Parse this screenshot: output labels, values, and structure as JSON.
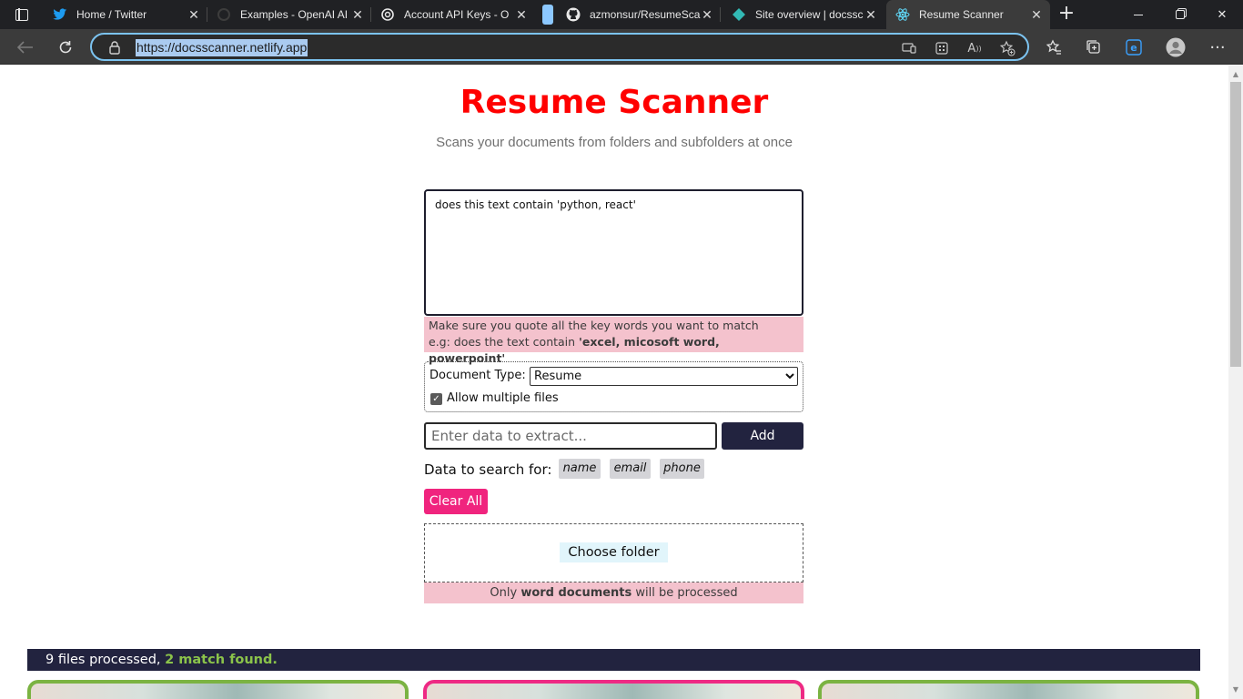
{
  "browser": {
    "tabs": [
      {
        "title": "",
        "icon": "tab-actions-icon"
      },
      {
        "title": "Home / Twitter",
        "icon": "twitter-icon"
      },
      {
        "title": "Examples - OpenAI AI",
        "icon": "openai-icon"
      },
      {
        "title": "Account API Keys - O",
        "icon": "openai-icon"
      },
      {
        "title": "",
        "icon": "blank-tab-icon"
      },
      {
        "title": "azmonsur/ResumeSca",
        "icon": "github-icon"
      },
      {
        "title": "Site overview | docssc",
        "icon": "netlify-icon"
      },
      {
        "title": "Resume Scanner",
        "icon": "react-icon"
      }
    ],
    "url": "https://docsscanner.netlify.app"
  },
  "page": {
    "title": "Resume Scanner",
    "subtitle": "Scans your documents from folders and subfolders at once",
    "query_value": "does this text contain 'python, react'",
    "hint_line1": "Make sure you quote all the key words you want to match",
    "hint_line2_prefix": "e.g: does the text contain ",
    "hint_line2_bold": "'excel, micosoft word, powerpoint'",
    "document_type_label": "Document Type:",
    "document_type_selected": "Resume",
    "allow_multiple_label": "Allow multiple files",
    "allow_multiple_checked": true,
    "extract_placeholder": "Enter data to extract...",
    "add_label": "Add",
    "search_for_label": "Data to search for:",
    "chips": [
      "name",
      "email",
      "phone"
    ],
    "clear_all_label": "Clear All",
    "choose_folder_label": "Choose folder",
    "drop_note_prefix": "Only ",
    "drop_note_bold": "word documents",
    "drop_note_suffix": " will be processed",
    "result_processed": "9 files processed, ",
    "result_match": "2 match found."
  },
  "colors": {
    "title": "#ff0000",
    "navy": "#22233f",
    "pink": "#f0247e",
    "hint_bg": "#f4c2cd",
    "match_green": "#8bc34a",
    "card_green_border": "#7bb342",
    "card_pink_border": "#ee2a84"
  }
}
